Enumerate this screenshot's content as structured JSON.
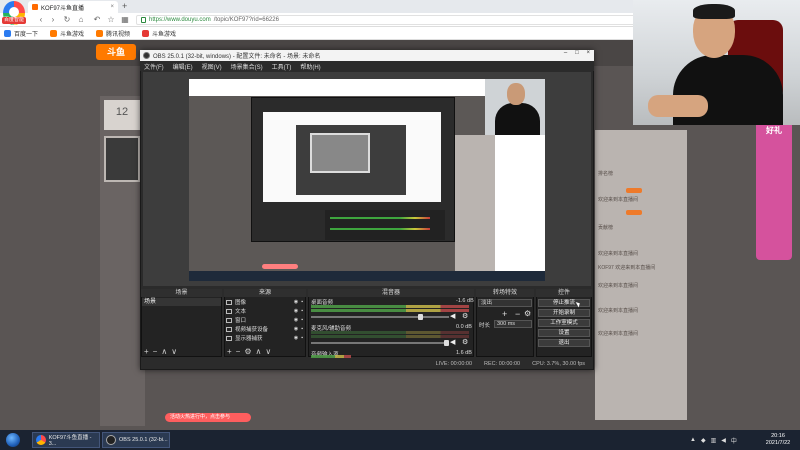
{
  "browser": {
    "logo_badge": "百度智能云",
    "tab_title": "KOF97斗鱼直播",
    "tab_close": "×",
    "new_tab": "+",
    "url_host": "https://www.douyu.com",
    "url_rest": "/topic/KOF97?rid=66226",
    "bookmarks": [
      "百度一下",
      "斗鱼游戏",
      "腾讯视频",
      "斗鱼游戏"
    ]
  },
  "page": {
    "site_logo": "斗鱼",
    "rank_number": "12",
    "promo_label": "好礼",
    "ad_bar_text": "活动火热进行中，点击参与",
    "chat_lines": [
      "排名榜",
      "欢迎来到本直播间",
      "贡献榜",
      "欢迎来到本直播间",
      "KOF97 欢迎来到本直播间",
      "欢迎来到本直播间",
      "欢迎来到本直播间",
      "欢迎来到本直播间"
    ]
  },
  "obs": {
    "title": "OBS 25.0.1 (32-bit, windows) - 配置文件: 未命名 - 场景: 未命名",
    "menu": [
      "文件(F)",
      "编辑(E)",
      "视图(V)",
      "场景集合(S)",
      "工具(T)",
      "帮助(H)"
    ],
    "docks": {
      "scenes": "场景",
      "sources": "来源",
      "mixer": "混音器",
      "transitions": "转场特效",
      "controls": "控件"
    },
    "scenes": [
      "场景"
    ],
    "sources": [
      "图像",
      "文本",
      "窗口",
      "视频捕获设备",
      "显示器捕获"
    ],
    "mixer": [
      {
        "label": "桌面音频",
        "db": "-1.6 dB"
      },
      {
        "label": "麦克风/辅助音频",
        "db": "0.0 dB"
      },
      {
        "label": "音频输入源",
        "db": "1.6 dB"
      }
    ],
    "transitions": {
      "selected": "淡出",
      "duration_label": "时长",
      "duration": "300 ms"
    },
    "controls": [
      "停止推流",
      "开始录制",
      "工作室模式",
      "设置",
      "退出"
    ],
    "status": [
      "LIVE: 00:00:00",
      "REC: 00:00:00",
      "CPU: 3.7%, 30.00 fps"
    ]
  },
  "taskbar": {
    "items": [
      "KOF97斗鱼直播 - 3...",
      "OBS 25.0.1 (32-bi..."
    ],
    "clock_time": "20:16",
    "clock_date": "2021/7/22"
  }
}
